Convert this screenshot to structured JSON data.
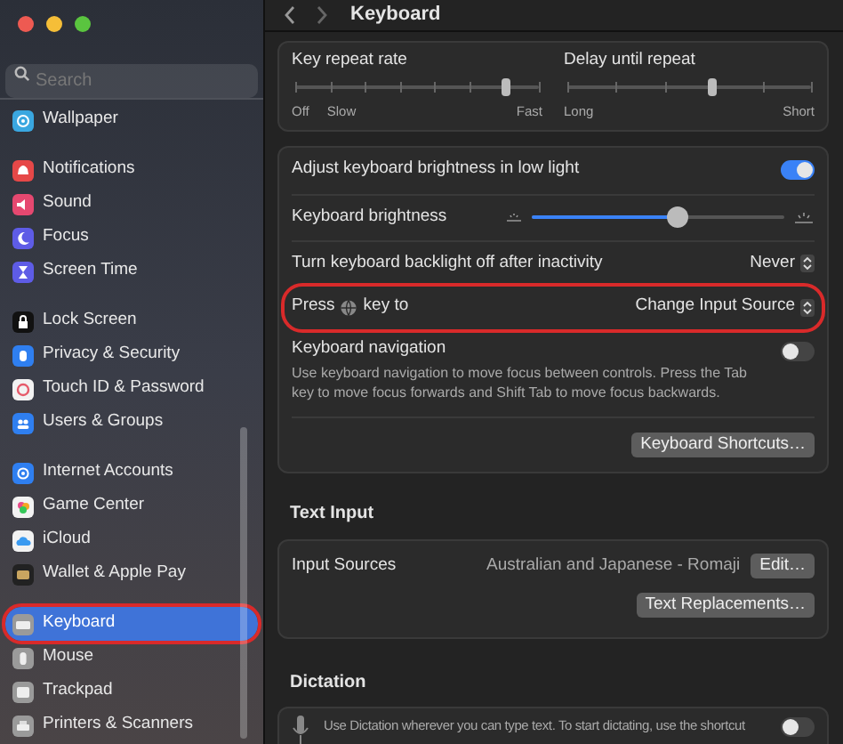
{
  "sidebar": {
    "search": {
      "placeholder": "Search"
    },
    "groups": [
      [
        {
          "label": "Wallpaper",
          "selected": false,
          "highlighted": false
        }
      ],
      [
        {
          "label": "Notifications",
          "selected": false,
          "highlighted": false
        },
        {
          "label": "Sound",
          "selected": false,
          "highlighted": false
        },
        {
          "label": "Focus",
          "selected": false,
          "highlighted": false
        },
        {
          "label": "Screen Time",
          "selected": false,
          "highlighted": false
        }
      ],
      [
        {
          "label": "Lock Screen",
          "selected": false,
          "highlighted": false
        },
        {
          "label": "Privacy & Security",
          "selected": false,
          "highlighted": false
        },
        {
          "label": "Touch ID & Password",
          "selected": false,
          "highlighted": false
        },
        {
          "label": "Users & Groups",
          "selected": false,
          "highlighted": false
        }
      ],
      [
        {
          "label": "Internet Accounts",
          "selected": false,
          "highlighted": false
        },
        {
          "label": "Game Center",
          "selected": false,
          "highlighted": false
        },
        {
          "label": "iCloud",
          "selected": false,
          "highlighted": false
        },
        {
          "label": "Wallet & Apple Pay",
          "selected": false,
          "highlighted": false
        }
      ],
      [
        {
          "label": "Keyboard",
          "selected": true,
          "highlighted": true
        },
        {
          "label": "Mouse",
          "selected": false,
          "highlighted": false
        },
        {
          "label": "Trackpad",
          "selected": false,
          "highlighted": false
        },
        {
          "label": "Printers & Scanners",
          "selected": false,
          "highlighted": false
        }
      ]
    ]
  },
  "window": {
    "title": "Keyboard"
  },
  "repeat": [
    {
      "label": "Key repeat rate",
      "level": 0.86,
      "min_labels": [
        "Off",
        "Slow"
      ],
      "max_label": "Fast"
    },
    {
      "label": "Delay until repeat",
      "level": 0.59,
      "min_labels": [
        "Long"
      ],
      "max_label": "Short"
    }
  ],
  "settings": [
    {
      "kind": "toggle",
      "label": "Adjust keyboard brightness in low light",
      "on": true,
      "highlighted": false
    },
    {
      "kind": "slider",
      "label": "Keyboard brightness",
      "level": 0.58,
      "highlighted": false
    },
    {
      "kind": "popup",
      "label": "Turn keyboard backlight off after inactivity",
      "value": "Never",
      "highlighted": false
    },
    {
      "kind": "globe_popup",
      "label_before": "Press",
      "label_after": "key to",
      "value": "Change Input Source",
      "highlighted": true
    },
    {
      "kind": "toggle_desc",
      "label": "Keyboard navigation",
      "on": false,
      "description": "Use keyboard navigation to move focus between controls. Press the Tab key to move focus forwards and Shift Tab to move focus backwards.",
      "highlighted": false
    },
    {
      "kind": "button",
      "label": "Keyboard Shortcuts…",
      "highlighted": false
    }
  ],
  "text_input": {
    "heading": "Text Input",
    "input_sources_label": "Input Sources",
    "input_sources_value": "Australian and Japanese - Romaji",
    "edit_button": "Edit…",
    "replacements_button": "Text Replacements…"
  },
  "dictation": {
    "heading": "Dictation",
    "description": "Use Dictation wherever you can type text. To start dictating, use the shortcut",
    "on": false
  }
}
